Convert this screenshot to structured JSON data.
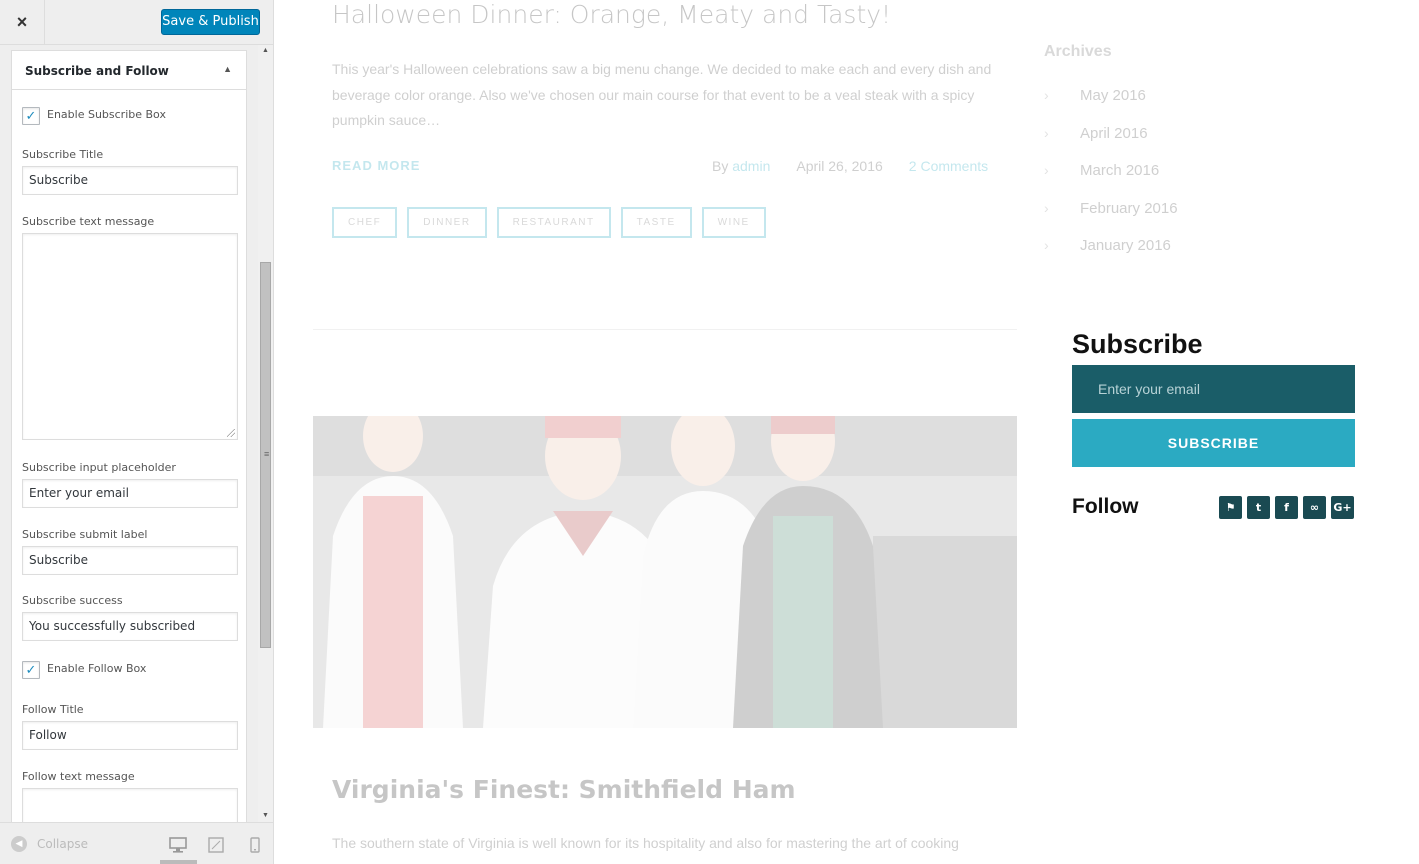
{
  "customizer": {
    "close_icon": "×",
    "publish_label": "Save & Publish",
    "section_title": "Subscribe and Follow",
    "section_arrow": "▲",
    "enable_subscribe_label": "Enable Subscribe Box",
    "enable_subscribe_checked": true,
    "subscribe_title_label": "Subscribe Title",
    "subscribe_title_value": "Subscribe",
    "subscribe_text_label": "Subscribe text message",
    "subscribe_text_value": "",
    "input_placeholder_label": "Subscribe input placeholder",
    "input_placeholder_value": "Enter your email",
    "submit_label_label": "Subscribe submit label",
    "submit_label_value": "Subscribe",
    "success_label": "Subscribe success",
    "success_value": "You successfully subscribed",
    "enable_follow_label": "Enable Follow Box",
    "enable_follow_checked": true,
    "follow_title_label": "Follow Title",
    "follow_title_value": "Follow",
    "follow_text_label": "Follow text message",
    "collapse_label": "Collapse",
    "check_glyph": "✓",
    "scroll_up": "▲",
    "scroll_down": "▼",
    "scroll_grip": "≡"
  },
  "preview": {
    "post1": {
      "title": "Halloween Dinner: Orange, Meaty and Tasty!",
      "excerpt": "This year's Halloween celebrations saw a big menu change. We decided to make each and every dish and beverage color orange. Also we've chosen our main course for that event to be a veal steak with a spicy pumpkin sauce…",
      "read_more": "READ MORE",
      "by": "By",
      "author": "admin",
      "date": "April 26, 2016",
      "comments": "2 Comments",
      "tags": [
        "CHEF",
        "DINNER",
        "RESTAURANT",
        "TASTE",
        "WINE"
      ]
    },
    "post2": {
      "title": "Virginia's Finest: Smithfield Ham",
      "excerpt": "The southern state of Virginia is well known for its hospitality and also for mastering the art of cooking"
    },
    "archives": {
      "title": "Archives",
      "items": [
        "May 2016",
        "April 2016",
        "March 2016",
        "February 2016",
        "January 2016"
      ]
    },
    "subscribe": {
      "title": "Subscribe",
      "placeholder": "Enter your email",
      "button": "SUBSCRIBE"
    },
    "follow": {
      "title": "Follow",
      "icons": [
        {
          "name": "foursquare-icon",
          "glyph": "⚑"
        },
        {
          "name": "twitter-icon",
          "glyph": "t"
        },
        {
          "name": "facebook-icon",
          "glyph": "f"
        },
        {
          "name": "tripadvisor-icon",
          "glyph": "∞"
        },
        {
          "name": "google-plus-icon",
          "glyph": "G+"
        }
      ]
    }
  },
  "colors": {
    "accent": "#2baac2",
    "subscribe_bg": "#1a5d68",
    "publish": "#0085ba",
    "social_bg": "#1a4a52"
  }
}
